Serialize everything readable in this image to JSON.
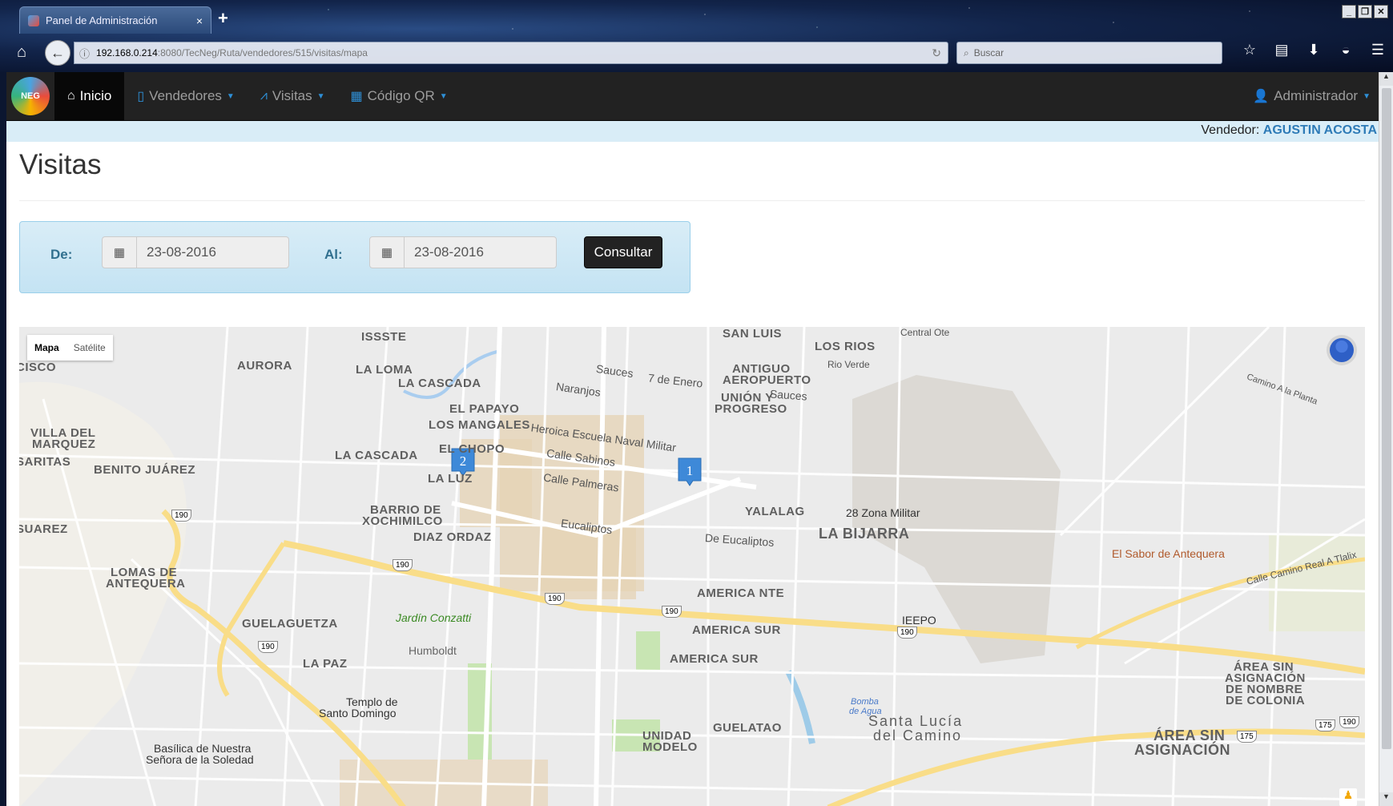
{
  "browser": {
    "tab_title": "Panel de Administración",
    "tab_close": "×",
    "new_tab": "+",
    "url_host": "192.168.0.214",
    "url_path": ":8080/TecNeg/Ruta/vendedores/515/visitas/mapa",
    "search_placeholder": "Buscar"
  },
  "navbar": {
    "brand_text": "NEG",
    "items": [
      {
        "label": "Inicio",
        "icon": "home-icon"
      },
      {
        "label": "Vendedores",
        "icon": "mobile-icon"
      },
      {
        "label": "Visitas",
        "icon": "road-icon"
      },
      {
        "label": "Código QR",
        "icon": "qrcode-icon"
      }
    ],
    "user": "Administrador"
  },
  "vendor": {
    "label": "Vendedor:",
    "name": "AGUSTIN ACOSTA"
  },
  "page": {
    "title": "Visitas"
  },
  "filter": {
    "from_label": "De:",
    "from_value": "23-08-2016",
    "to_label": "Al:",
    "to_value": "23-08-2016",
    "submit_label": "Consultar"
  },
  "map": {
    "type_buttons": [
      "Mapa",
      "Satélite"
    ],
    "markers": [
      {
        "label": "1"
      },
      {
        "label": "2"
      }
    ],
    "labels": {
      "issste": "ISSSTE",
      "aurora": "AURORA",
      "la_loma": "LA LOMA",
      "la_cascada_n": "LA CASCADA",
      "el_papayo": "EL PAPAYO",
      "los_mangales": "LOS MANGALES",
      "el_chopo": "EL CHOPO",
      "la_cascada": "LA CASCADA",
      "la_luz": "LA LUZ",
      "benito_juarez": "BENITO JUÁREZ",
      "villa_del_marquez_1": "VILLA DEL",
      "villa_del_marquez_2": "MARQUEZ",
      "saritas": "SARITAS",
      "suarez": "SUAREZ",
      "cisco": "CISCO",
      "barrio_1": "BARRIO DE",
      "barrio_2": "XOCHIMILCO",
      "diaz_ordaz": "DIAZ ORDAZ",
      "lomas_1": "LOMAS DE",
      "lomas_2": "ANTEQUERA",
      "guelaguetza": "GUELAGUETZA",
      "jardin": "Jardín Conzatti",
      "humboldt": "Humboldt",
      "la_paz": "LA PAZ",
      "templo_1": "Templo de",
      "templo_2": "Santo Domingo",
      "basilica_1": "Basílica de Nuestra",
      "basilica_2": "Señora de la Soledad",
      "san_luis": "SAN LUIS",
      "los_rios": "LOS RIOS",
      "rio_verde": "Rio Verde",
      "central": "Central Ote",
      "antiguo_1": "ANTIGUO",
      "antiguo_2": "AEROPUERTO",
      "union_1": "UNIÓN Y",
      "union_2": "PROGRESO",
      "yalalag": "YALALAG",
      "zona_militar": "28 Zona Militar",
      "la_bijarra": "LA BIJARRA",
      "america_nte": "AMERICA NTE",
      "america_sur_1": "AMERICA SUR",
      "america_sur_2": "AMERICA SUR",
      "ieepo": "IEEPO",
      "el_sabor": "El Sabor de Antequera",
      "unidad_1": "UNIDAD",
      "unidad_2": "MODELO",
      "guelatao": "GUELATAO",
      "santa_lucia_1": "Santa Lucía",
      "santa_lucia_2": "del Camino",
      "bomba_1": "Bomba",
      "bomba_2": "de Agua",
      "area_1": "ÁREA SIN",
      "area_2": "ASIGNACIÓN",
      "area_3": "DE NOMBRE",
      "area_4": "DE COLONIA",
      "area_b1": "ÁREA SIN",
      "area_b2": "ASIGNACIÓN",
      "heroica": "Heroica Escuela Naval Militar",
      "sabinos": "Calle Sabinos",
      "palmeras": "Calle Palmeras",
      "eucaliptos": "Eucaliptos",
      "de_eucaliptos": "De Eucaliptos",
      "naranjos": "Naranjos",
      "sauces": "Sauces",
      "sauces2": "Sauces",
      "enero": "7 de Enero",
      "camino_planta": "Camino A la Planta",
      "calle_camino": "Calle Camino Real A Tlalix",
      "r190a": "190",
      "r190b": "190",
      "r190c": "190",
      "r190d": "190",
      "r190e": "190",
      "r190f": "190",
      "r190g": "190",
      "r175a": "175",
      "r175b": "175"
    }
  }
}
